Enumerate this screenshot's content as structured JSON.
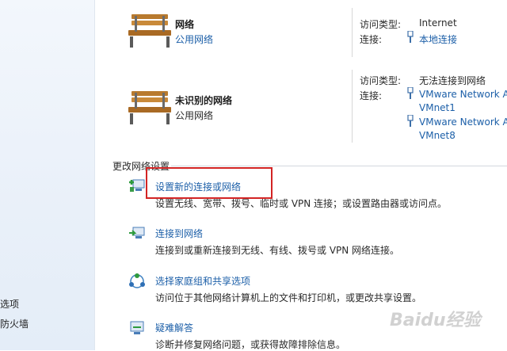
{
  "sidebar": {
    "items": [
      {
        "label": "选项"
      },
      {
        "label": "防火墙"
      }
    ]
  },
  "networks": [
    {
      "name": "网络",
      "category": "公用网络",
      "access_type_label": "访问类型:",
      "access_type_value": "Internet",
      "connection_label": "连接:",
      "connections": [
        {
          "line1": "本地连接"
        }
      ]
    },
    {
      "name": "未识别的网络",
      "category": "公用网络",
      "access_type_label": "访问类型:",
      "access_type_value": "无法连接到网络",
      "connection_label": "连接:",
      "connections": [
        {
          "line1": "VMware Network A",
          "line2": "VMnet1"
        },
        {
          "line1": "VMware Network A",
          "line2": "VMnet8"
        }
      ]
    }
  ],
  "section": {
    "title": "更改网络设置"
  },
  "tasks": [
    {
      "title": "设置新的连接或网络",
      "desc": "设置无线、宽带、拨号、临时或 VPN 连接；或设置路由器或访问点。",
      "icon": "new-connection-icon"
    },
    {
      "title": "连接到网络",
      "desc": "连接到或重新连接到无线、有线、拨号或 VPN 网络连接。",
      "icon": "connect-network-icon"
    },
    {
      "title": "选择家庭组和共享选项",
      "desc": "访问位于其他网络计算机上的文件和打印机，或更改共享设置。",
      "icon": "homegroup-icon"
    },
    {
      "title": "疑难解答",
      "desc": "诊断并修复网络问题，或获得故障排除信息。",
      "icon": "troubleshoot-icon"
    }
  ],
  "colors": {
    "link": "#1c5fa8",
    "highlight": "#d32424"
  },
  "watermark": {
    "text": "Baidu经验"
  }
}
